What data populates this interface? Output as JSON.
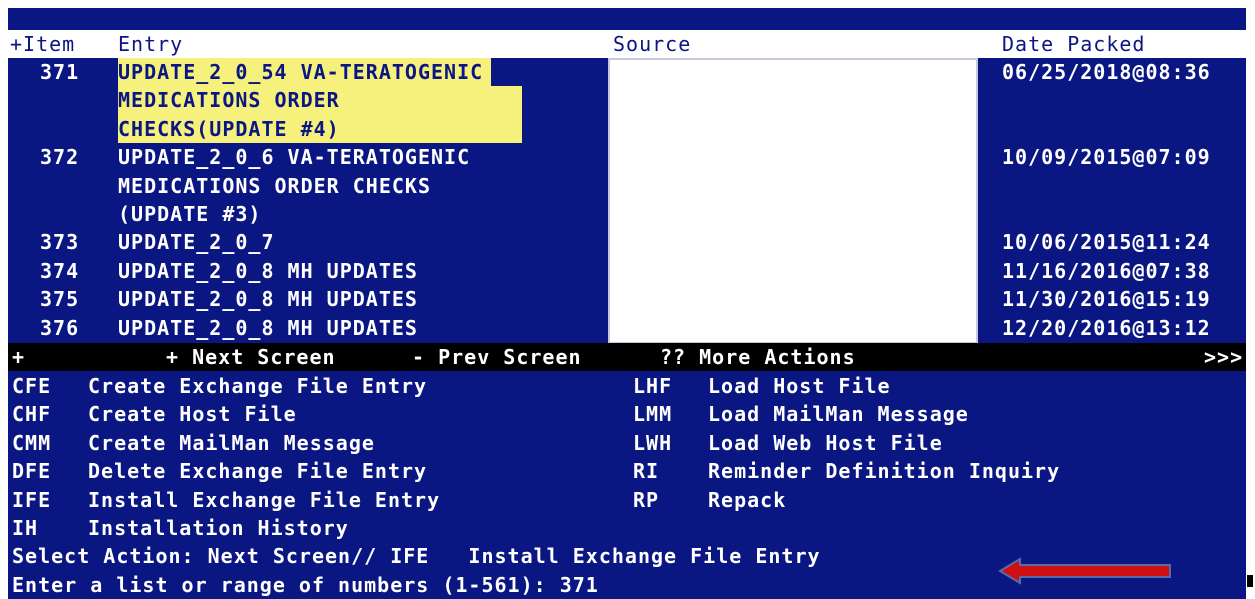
{
  "header": {
    "item": "+Item",
    "entry": "Entry",
    "source": "Source",
    "date": "Date Packed"
  },
  "rows": [
    {
      "item": "371",
      "entry": "UPDATE_2_0_54 VA-TERATOGENIC",
      "date": "06/25/2018@08:36"
    },
    {
      "item": "",
      "entry": "MEDICATIONS ORDER",
      "date": ""
    },
    {
      "item": "",
      "entry": "CHECKS(UPDATE #4)",
      "date": ""
    },
    {
      "item": "372",
      "entry": "UPDATE_2_0_6 VA-TERATOGENIC",
      "date": "10/09/2015@07:09"
    },
    {
      "item": "",
      "entry": "MEDICATIONS ORDER CHECKS",
      "date": ""
    },
    {
      "item": "",
      "entry": "(UPDATE #3)",
      "date": ""
    },
    {
      "item": "373",
      "entry": "UPDATE_2_0_7",
      "date": "10/06/2015@11:24"
    },
    {
      "item": "374",
      "entry": "UPDATE_2_0_8 MH UPDATES",
      "date": "11/16/2016@07:38"
    },
    {
      "item": "375",
      "entry": "UPDATE_2_0_8 MH UPDATES",
      "date": "11/30/2016@15:19"
    },
    {
      "item": "376",
      "entry": "UPDATE_2_0_8 MH UPDATES",
      "date": "12/20/2016@13:12"
    }
  ],
  "navbar": {
    "plus": "+",
    "next": "+ Next Screen",
    "prev": "- Prev Screen",
    "more": "?? More Actions",
    "more_indicator": ">>>"
  },
  "actions_left": [
    {
      "code": "CFE",
      "label": "Create Exchange File Entry"
    },
    {
      "code": "CHF",
      "label": "Create Host File"
    },
    {
      "code": "CMM",
      "label": "Create MailMan Message"
    },
    {
      "code": "DFE",
      "label": "Delete Exchange File Entry"
    },
    {
      "code": "IFE",
      "label": "Install Exchange File Entry"
    },
    {
      "code": "IH",
      "label": "Installation History"
    }
  ],
  "actions_right": [
    {
      "code": "LHF",
      "label": "Load Host File"
    },
    {
      "code": "LMM",
      "label": "Load MailMan Message"
    },
    {
      "code": "LWH",
      "label": "Load Web Host File"
    },
    {
      "code": "RI",
      "label": "Reminder Definition Inquiry"
    },
    {
      "code": "RP",
      "label": "Repack"
    }
  ],
  "prompt1": "Select Action: Next Screen// IFE   Install Exchange File Entry",
  "prompt2": "Enter a list or range of numbers (1-561): 371",
  "colors": {
    "terminal_bg": "#0a1682",
    "highlight": "#f6f07c",
    "arrow": "#d01010"
  }
}
